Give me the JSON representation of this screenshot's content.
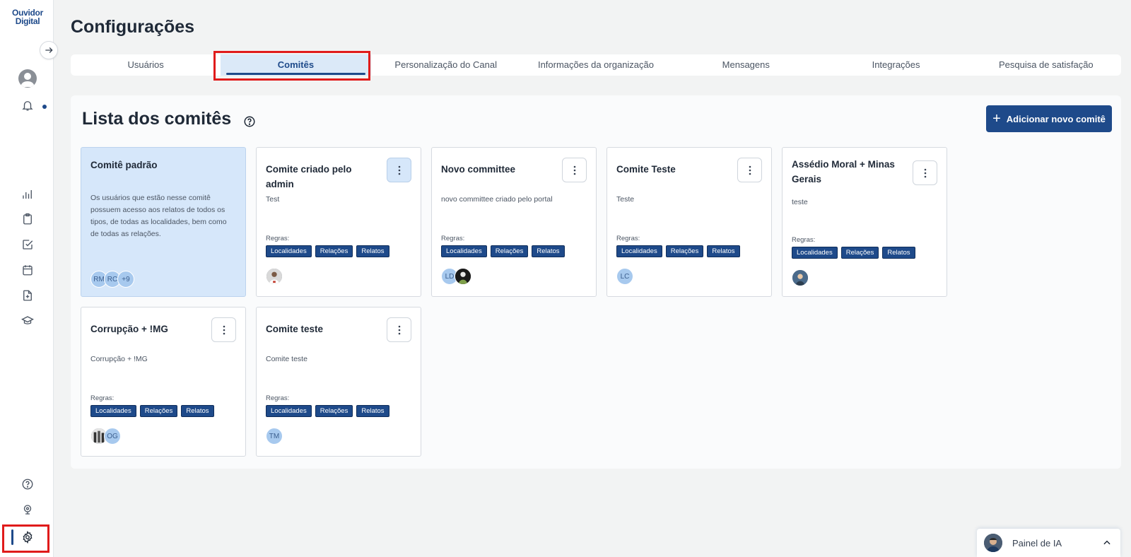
{
  "app": {
    "logo_line1": "Ouvidor",
    "logo_line2": "Digital"
  },
  "page": {
    "title": "Configurações"
  },
  "tabs": [
    {
      "label": "Usuários",
      "active": false
    },
    {
      "label": "Comitês",
      "active": true
    },
    {
      "label": "Personalização do Canal",
      "active": false
    },
    {
      "label": "Informações da organização",
      "active": false
    },
    {
      "label": "Mensagens",
      "active": false
    },
    {
      "label": "Integrações",
      "active": false
    },
    {
      "label": "Pesquisa de satisfação",
      "active": false
    }
  ],
  "committees_section": {
    "title": "Lista dos comitês",
    "add_button_label": "Adicionar novo comitê",
    "rules_label": "Regras:"
  },
  "committees": [
    {
      "title": "Comitê padrão",
      "description": "Os usuários que estão nesse comitê possuem acesso aos relatos de todos os tipos, de todas as localidades, bem como de todas as relações.",
      "default": true,
      "members": [
        "RM",
        "RC",
        "+9"
      ]
    },
    {
      "title": "Comite criado pelo admin",
      "description": "Test",
      "rules": [
        "Localidades",
        "Relações",
        "Relatos"
      ],
      "members": [
        "photo"
      ]
    },
    {
      "title": "Novo committee",
      "description": "novo committee criado pelo portal",
      "rules": [
        "Localidades",
        "Relações",
        "Relatos"
      ],
      "members": [
        "LD",
        "photo"
      ]
    },
    {
      "title": "Comite Teste",
      "description": "Teste",
      "rules": [
        "Localidades",
        "Relações",
        "Relatos"
      ],
      "members": [
        "LC"
      ]
    },
    {
      "title": "Assédio Moral + Minas Gerais",
      "description": "teste",
      "rules": [
        "Localidades",
        "Relações",
        "Relatos"
      ],
      "members": [
        "photo"
      ]
    },
    {
      "title": "Corrupção + !MG",
      "description": "Corrupção + !MG",
      "rules": [
        "Localidades",
        "Relações",
        "Relatos"
      ],
      "members": [
        "photo",
        "OG"
      ]
    },
    {
      "title": "Comite teste",
      "description": "Comite teste",
      "rules": [
        "Localidades",
        "Relações",
        "Relatos"
      ],
      "members": [
        "TM"
      ]
    }
  ],
  "ai_panel": {
    "label": "Painel de IA"
  },
  "colors": {
    "brand": "#1e4a8a",
    "highlight": "#e01b1b",
    "active_tab_bg": "#dbe9f8"
  }
}
